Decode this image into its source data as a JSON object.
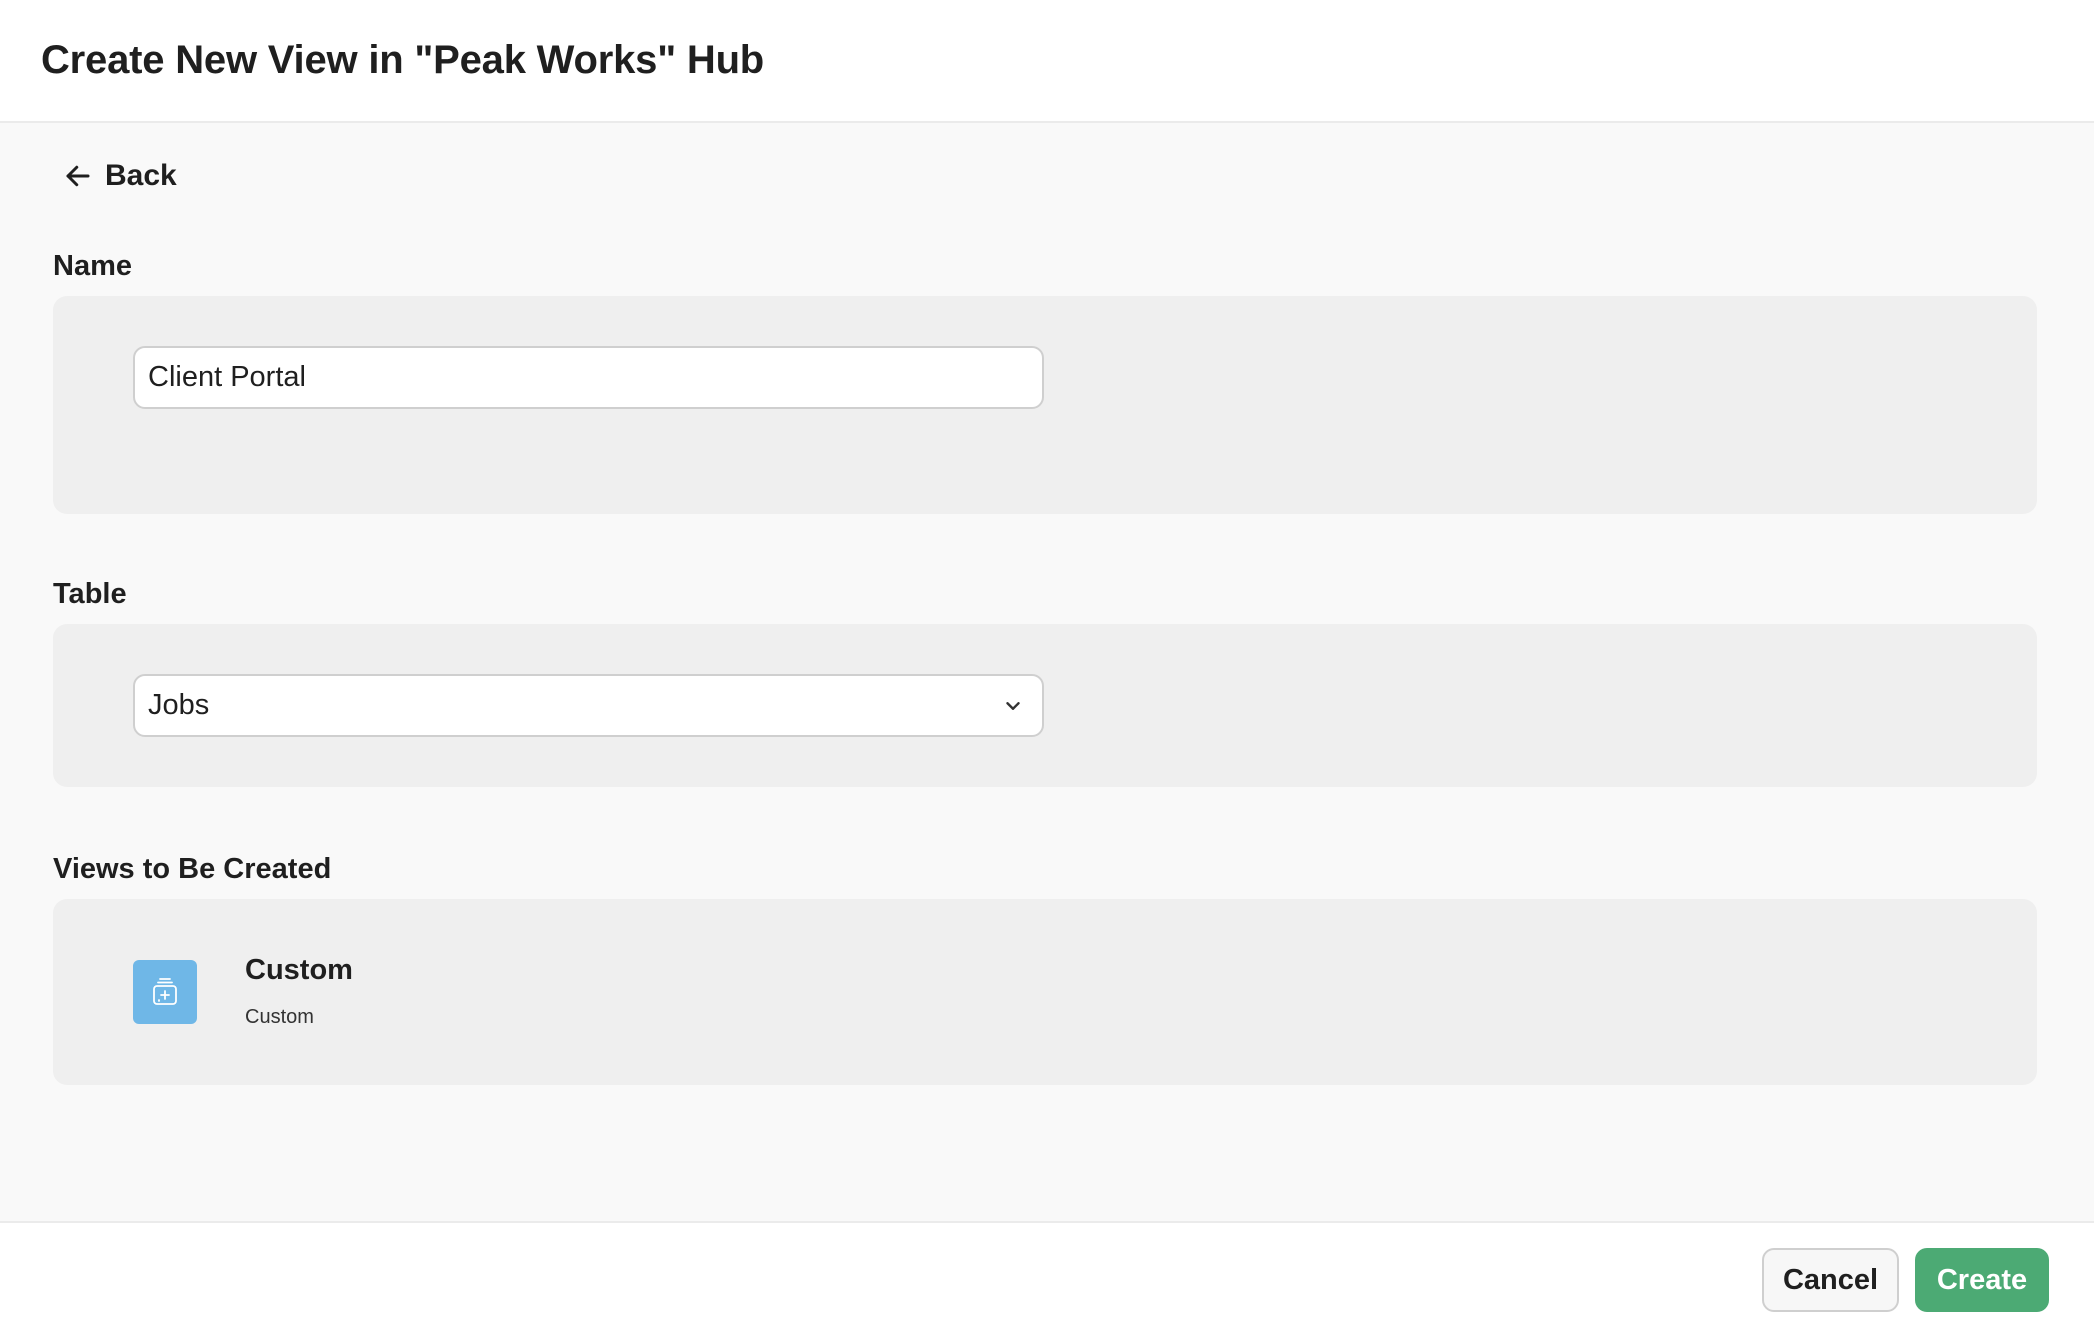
{
  "header": {
    "title": "Create New View in \"Peak Works\" Hub"
  },
  "back": {
    "label": "Back",
    "icon": "arrow-left-icon"
  },
  "name_section": {
    "label": "Name",
    "input_value": "Client Portal",
    "placeholder": ""
  },
  "table_section": {
    "label": "Table",
    "selected": "Jobs",
    "icon": "chevron-down-icon"
  },
  "views_section": {
    "label": "Views to Be Created",
    "items": [
      {
        "title": "Custom",
        "subtitle": "Custom",
        "icon": "custom-view-icon",
        "icon_color": "#6fb7e7"
      }
    ]
  },
  "footer": {
    "cancel_label": "Cancel",
    "create_label": "Create",
    "accent_color": "#4caa74"
  }
}
